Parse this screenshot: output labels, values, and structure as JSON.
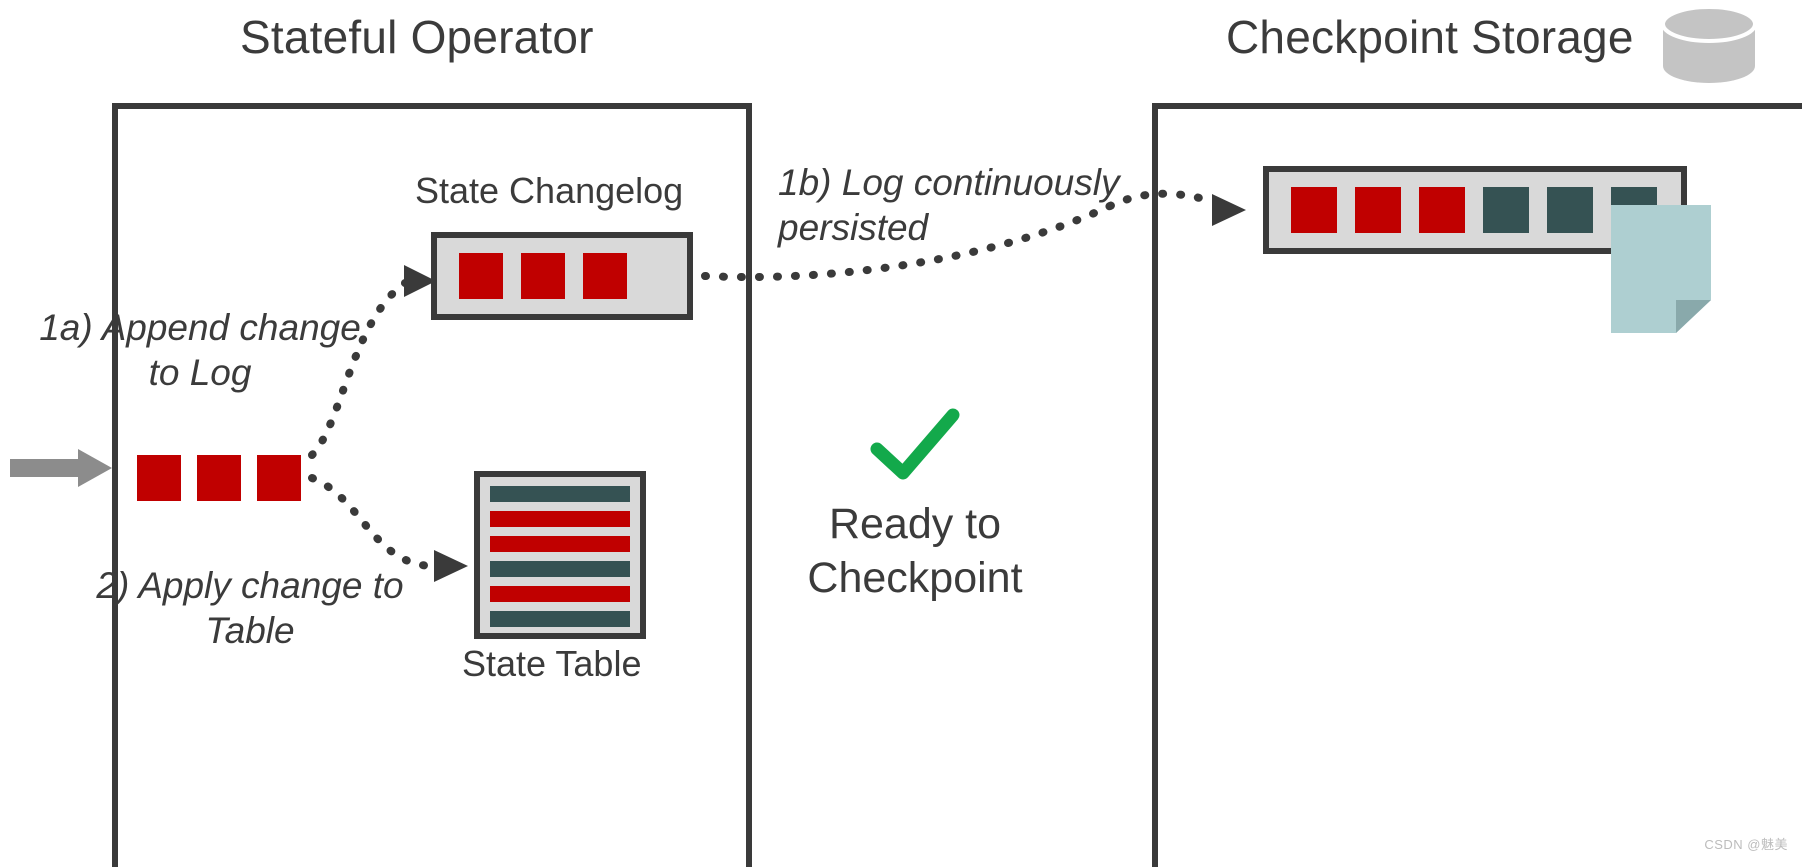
{
  "diagram": {
    "left_panel_title": "Stateful Operator",
    "right_panel_title": "Checkpoint Storage",
    "changelog_caption": "State Changelog",
    "state_table_caption": "State Table",
    "annotations": {
      "step_1a": "1a) Append change to Log",
      "step_1b": "1b) Log continuously persisted",
      "step_2": "2) Apply change to Table"
    },
    "status": {
      "check_icon": "green-check-icon",
      "label": "Ready to Checkpoint"
    },
    "icons": {
      "database": "database-cylinder-icon",
      "document": "document-page-icon",
      "input_arrow": "input-arrow-icon"
    },
    "changelog_cells": [
      "red",
      "red",
      "red"
    ],
    "storage_cells": [
      "red",
      "red",
      "red",
      "teal",
      "teal",
      "teal"
    ],
    "input_cells": [
      "red",
      "red",
      "red"
    ],
    "state_table_rows": [
      "teal",
      "red",
      "red",
      "teal",
      "red",
      "teal"
    ],
    "colors": {
      "red": "#C00000",
      "teal": "#355253",
      "outline": "#3A3A3A",
      "strip_fill": "#D9D9D9",
      "check_green": "#13A94B",
      "arrow_gray": "#8C8C8C",
      "document_fill": "#AECFD1",
      "cylinder_fill": "#C4C4C4",
      "text": "#3B3B3B"
    }
  },
  "watermark": "CSDN @魅美"
}
